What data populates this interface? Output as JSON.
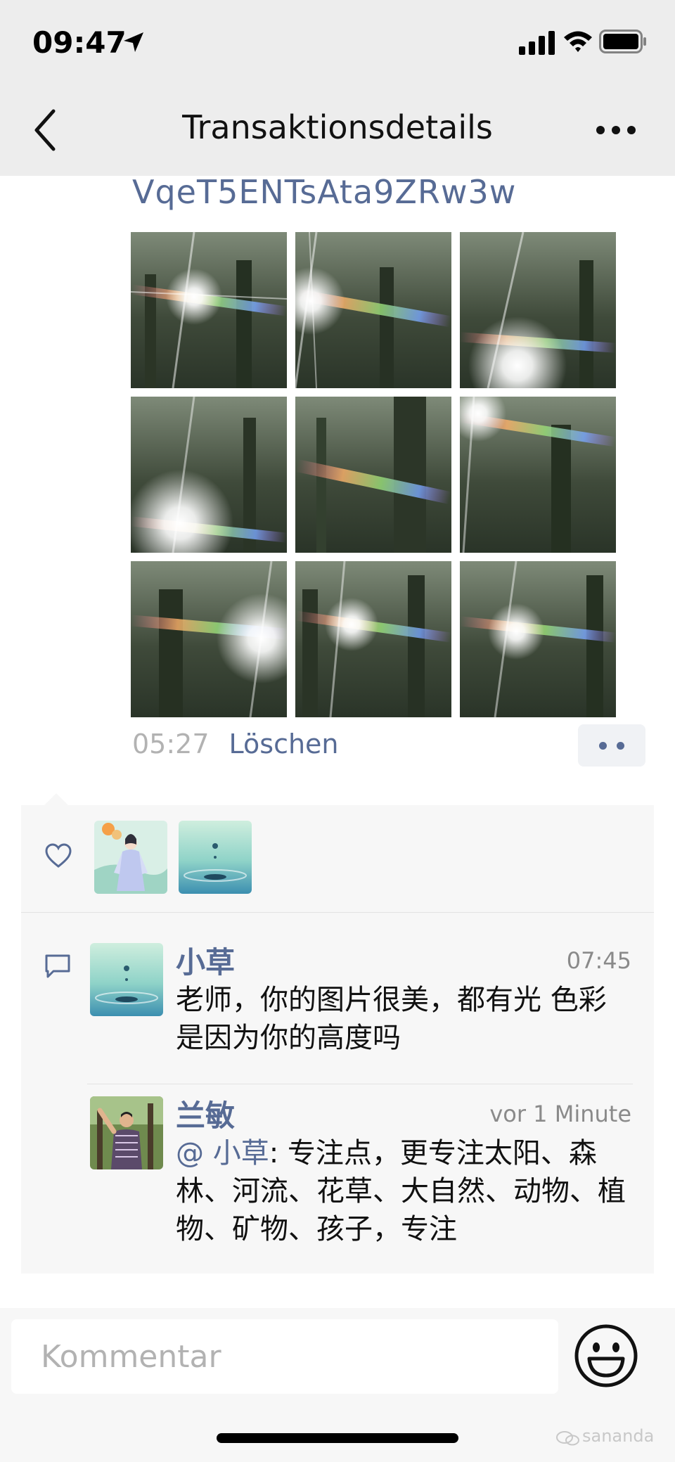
{
  "status_bar": {
    "time": "09:47"
  },
  "nav": {
    "title": "Transaktionsdetails"
  },
  "post": {
    "text": "VqeT5ENTsAta9ZRw3w",
    "time": "05:27",
    "delete_label": "Löschen",
    "photo_count": 9
  },
  "likes": {
    "count": 2
  },
  "comments": [
    {
      "author": "小草",
      "time": "07:45",
      "text": "老师，你的图片很美，都有光 色彩 是因为你的高度吗"
    },
    {
      "author": "兰敏",
      "time": "vor 1 Minute",
      "mention": "@ 小草",
      "text": ": 专注点，更专注太阳、森林、河流、花草、大自然、动物、植物、矿物、孩子，专注"
    }
  ],
  "comment_input": {
    "placeholder": "Kommentar"
  },
  "watermark": {
    "text": "sananda"
  },
  "colors": {
    "link": "#576b95",
    "background": "#ededed",
    "panel": "#f7f7f7"
  }
}
